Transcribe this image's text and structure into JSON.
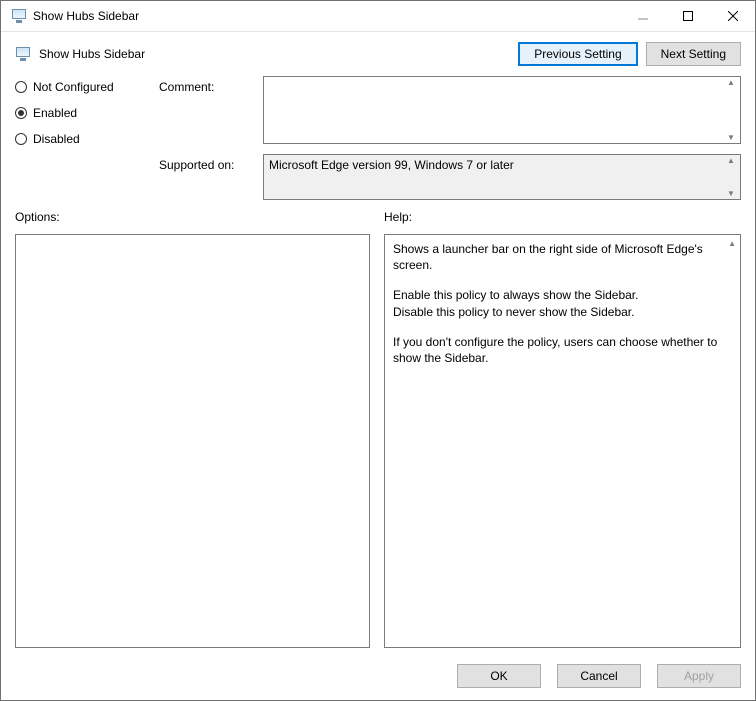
{
  "window": {
    "title": "Show Hubs Sidebar"
  },
  "header": {
    "iconAlt": "policy-icon",
    "policy_title": "Show Hubs Sidebar",
    "prev_label": "Previous Setting",
    "next_label": "Next Setting"
  },
  "state": {
    "not_configured_label": "Not Configured",
    "enabled_label": "Enabled",
    "disabled_label": "Disabled",
    "selected": "enabled"
  },
  "fields": {
    "comment_label": "Comment:",
    "comment_value": "",
    "supported_label": "Supported on:",
    "supported_value": "Microsoft Edge version 99, Windows 7 or later"
  },
  "sections": {
    "options_label": "Options:",
    "help_label": "Help:"
  },
  "help": {
    "p1": "Shows a launcher bar on the right side of Microsoft Edge's screen.",
    "p2a": "Enable this policy to always show the Sidebar.",
    "p2b": "Disable this policy to never show the Sidebar.",
    "p3": "If you don't configure the policy, users can choose whether to show the Sidebar."
  },
  "footer": {
    "ok_label": "OK",
    "cancel_label": "Cancel",
    "apply_label": "Apply"
  }
}
